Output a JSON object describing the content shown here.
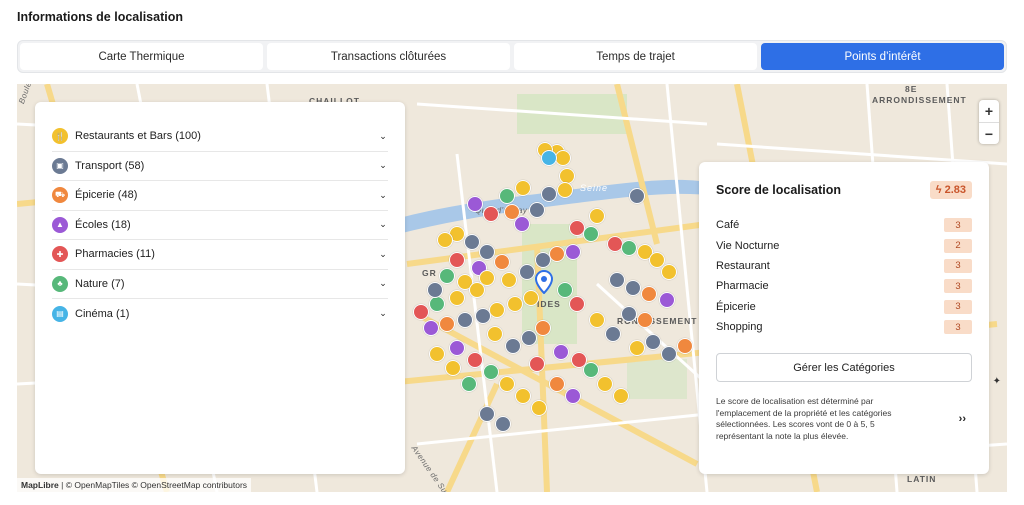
{
  "header": {
    "title": "Informations de localisation"
  },
  "tabs": [
    {
      "label": "Carte Thermique",
      "active": false
    },
    {
      "label": "Transactions clôturées",
      "active": false
    },
    {
      "label": "Temps de trajet",
      "active": false
    },
    {
      "label": "Points d’intérêt",
      "active": true
    }
  ],
  "colors": {
    "accent": "#2e6fe6",
    "restaurants": "#f2c12e",
    "transport": "#6b7a93",
    "epicerie": "#f0883e",
    "ecoles": "#9b59d6",
    "pharmacies": "#e35656",
    "nature": "#57b87a",
    "cinema": "#46b4e6",
    "score_badge_bg": "#f9dcc8"
  },
  "categories": [
    {
      "label": "Restaurants et Bars (100)",
      "icon": "fork-knife-icon"
    },
    {
      "label": "Transport (58)",
      "icon": "bus-icon"
    },
    {
      "label": "Épicerie (48)",
      "icon": "cart-icon"
    },
    {
      "label": "Écoles (18)",
      "icon": "graduation-cap-icon"
    },
    {
      "label": "Pharmacies (11)",
      "icon": "first-aid-icon"
    },
    {
      "label": "Nature (7)",
      "icon": "tree-icon"
    },
    {
      "label": "Cinéma (1)",
      "icon": "film-icon"
    }
  ],
  "score": {
    "title": "Score de localisation",
    "total": "2.83",
    "items": [
      {
        "name": "Café",
        "value": "3"
      },
      {
        "name": "Vie Nocturne",
        "value": "2"
      },
      {
        "name": "Restaurant",
        "value": "3"
      },
      {
        "name": "Pharmacie",
        "value": "3"
      },
      {
        "name": "Épicerie",
        "value": "3"
      },
      {
        "name": "Shopping",
        "value": "3"
      }
    ],
    "manage_label": "Gérer les Catégories",
    "description": "Le score de localisation est déterminé par l'emplacement de la propriété et les catégories sélectionnées. Les scores vont de 0 à 5, 5 représentant la note la plus élevée.",
    "more_label": "››"
  },
  "map": {
    "labels": {
      "chaillot": "CHAILLOT",
      "arrondissement_8": "8E",
      "arrondissement_label": "ARRONDISSEMENT",
      "seine": "Seine",
      "quai": "Quai d'Orsay",
      "invalides": "IDES",
      "gr": "GR",
      "rondissement": "RONDISSEMENT",
      "avenue": "Avenue de Suffr",
      "latin": "LATIN",
      "boule": "Boule"
    },
    "zoom_in": "+",
    "zoom_out": "−",
    "compass": "✦",
    "attribution_brand": "MapLibre",
    "attribution_text": " | © OpenMapTiles © OpenStreetMap contributors"
  }
}
